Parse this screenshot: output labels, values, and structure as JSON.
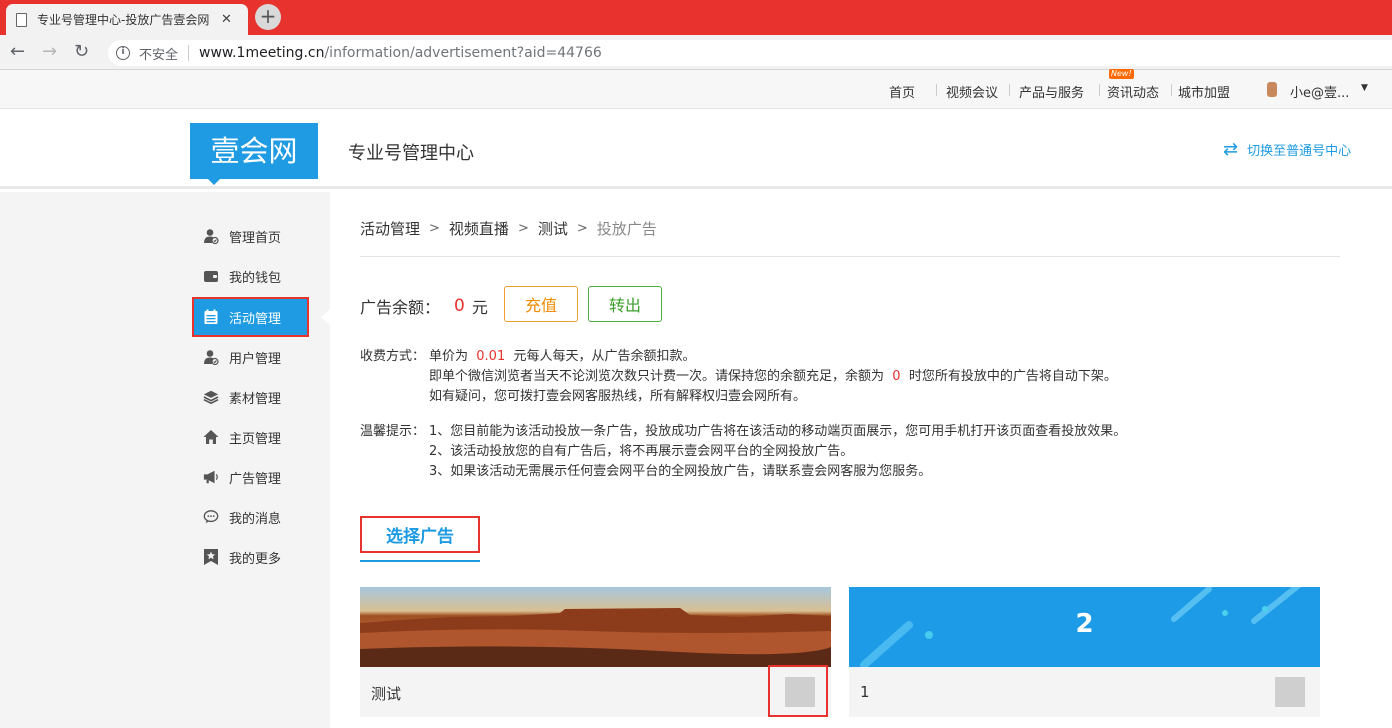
{
  "browser": {
    "tab_title": "专业号管理中心-投放广告壹会网",
    "tab_close": "✕",
    "new_tab": "+",
    "security_label": "不安全",
    "url_host": "www.1meeting.cn",
    "url_path": "/information/advertisement?aid=44766"
  },
  "topnav": {
    "items": [
      {
        "label": "首页"
      },
      {
        "label": "视频会议"
      },
      {
        "label": "产品与服务"
      },
      {
        "label": "资讯动态"
      },
      {
        "label": "城市加盟"
      }
    ],
    "new_badge": "New!",
    "user": "小e@壹..."
  },
  "header": {
    "logo_text": "壹会网",
    "title": "专业号管理中心",
    "switch_label": "切换至普通号中心"
  },
  "sidebar": {
    "items": [
      {
        "label": "管理首页",
        "icon": "user-check-icon"
      },
      {
        "label": "我的钱包",
        "icon": "wallet-icon"
      },
      {
        "label": "活动管理",
        "icon": "calendar-icon"
      },
      {
        "label": "用户管理",
        "icon": "user-check-icon"
      },
      {
        "label": "素材管理",
        "icon": "layers-icon"
      },
      {
        "label": "主页管理",
        "icon": "home-icon"
      },
      {
        "label": "广告管理",
        "icon": "megaphone-icon"
      },
      {
        "label": "我的消息",
        "icon": "chat-icon"
      },
      {
        "label": "我的更多",
        "icon": "star-icon"
      }
    ],
    "active_index": 2
  },
  "breadcrumb": {
    "items": [
      "活动管理",
      "视频直播",
      "测试",
      "投放广告"
    ],
    "separator": ">"
  },
  "balance": {
    "label": "广告余额：",
    "amount": "0",
    "unit": "元",
    "recharge_button": "充值",
    "transfer_button": "转出"
  },
  "fee": {
    "label": "收费方式：",
    "line1_prefix": "单价为",
    "price": "0.01",
    "line1_suffix": "元每人每天，从广告余额扣款。",
    "line2_prefix": "即单个微信浏览者当天不论浏览次数只计费一次。请保持您的余额充足，余额为",
    "threshold": "0",
    "line2_suffix": "时您所有投放中的广告将自动下架。",
    "line3": "如有疑问，您可拨打壹会网客服热线，所有解释权归壹会网所有。"
  },
  "tips": {
    "label": "温馨提示：",
    "lines": [
      "1、您目前能为该活动投放一条广告，投放成功广告将在该活动的移动端页面展示，您可用手机打开该页面查看投放效果。",
      "2、该活动投放您的自有广告后，将不再展示壹会网平台的全网投放广告。",
      "3、如果该活动无需展示任何壹会网平台的全网投放广告，请联系壹会网客服为您服务。"
    ]
  },
  "select_tab": "选择广告",
  "ads": [
    {
      "caption": "测试",
      "thumb": "desert-landscape-image"
    },
    {
      "caption": "1",
      "thumb_text": "2"
    }
  ],
  "colors": {
    "accent": "#1e9be2",
    "highlight": "#e8322d",
    "browser_tabstrip": "#e8322d",
    "recharge": "#f08c00",
    "transfer": "#3c9e2c"
  }
}
